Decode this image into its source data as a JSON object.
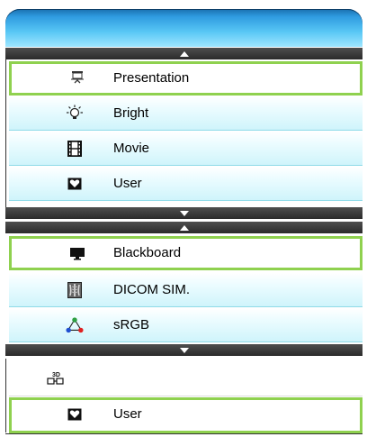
{
  "menu": {
    "group1": [
      {
        "label": "Presentation",
        "icon": "presentation-screen-icon"
      },
      {
        "label": "Bright",
        "icon": "lightbulb-icon"
      },
      {
        "label": "Movie",
        "icon": "film-icon"
      },
      {
        "label": "User",
        "icon": "heart-icon"
      }
    ],
    "group2": [
      {
        "label": "Blackboard",
        "icon": "blackboard-icon"
      },
      {
        "label": "DICOM SIM.",
        "icon": "xray-icon"
      },
      {
        "label": "sRGB",
        "icon": "rgb-triangle-icon"
      }
    ],
    "group3": [
      {
        "label": "",
        "icon": "3d-icon"
      },
      {
        "label": "User",
        "icon": "heart-icon"
      }
    ]
  },
  "colors": {
    "active_border": "#8fd14f",
    "header_top": "#1a6fae",
    "header_bottom": "#9fe6ff",
    "scrollbar": "#2b2b2b"
  }
}
